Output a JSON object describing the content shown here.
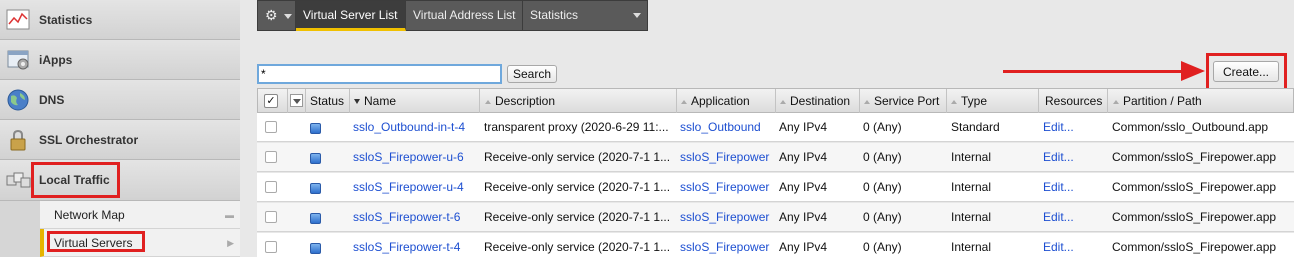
{
  "sidebar": {
    "items": [
      {
        "label": "Statistics",
        "icon": "statistics-icon"
      },
      {
        "label": "iApps",
        "icon": "iapps-icon"
      },
      {
        "label": "DNS",
        "icon": "dns-globe-icon"
      },
      {
        "label": "SSL Orchestrator",
        "icon": "lock-icon"
      },
      {
        "label": "Local Traffic",
        "icon": "local-traffic-icon"
      }
    ],
    "subitems": [
      {
        "label": "Network Map"
      },
      {
        "label": "Virtual Servers"
      }
    ]
  },
  "tabs": [
    {
      "label": "Virtual Server List"
    },
    {
      "label": "Virtual Address List"
    },
    {
      "label": "Statistics"
    }
  ],
  "gear_icon": "gear-icon",
  "search": {
    "value": "*",
    "button_label": "Search"
  },
  "create_button": "Create...",
  "columns": {
    "status": "Status",
    "name": "Name",
    "description": "Description",
    "application": "Application",
    "destination": "Destination",
    "service_port": "Service Port",
    "type": "Type",
    "resources": "Resources",
    "partition": "Partition / Path"
  },
  "rows": [
    {
      "name": "sslo_Outbound-in-t-4",
      "description": "transparent proxy (2020-6-29 11:...",
      "application": "sslo_Outbound",
      "destination": "Any IPv4",
      "port": "0 (Any)",
      "type": "Standard",
      "resources": "Edit...",
      "partition": "Common/sslo_Outbound.app"
    },
    {
      "name": "ssloS_Firepower-u-6",
      "description": "Receive-only service (2020-7-1 1...",
      "application": "ssloS_Firepower",
      "destination": "Any IPv4",
      "port": "0 (Any)",
      "type": "Internal",
      "resources": "Edit...",
      "partition": "Common/ssloS_Firepower.app"
    },
    {
      "name": "ssloS_Firepower-u-4",
      "description": "Receive-only service (2020-7-1 1...",
      "application": "ssloS_Firepower",
      "destination": "Any IPv4",
      "port": "0 (Any)",
      "type": "Internal",
      "resources": "Edit...",
      "partition": "Common/ssloS_Firepower.app"
    },
    {
      "name": "ssloS_Firepower-t-6",
      "description": "Receive-only service (2020-7-1 1...",
      "application": "ssloS_Firepower",
      "destination": "Any IPv4",
      "port": "0 (Any)",
      "type": "Internal",
      "resources": "Edit...",
      "partition": "Common/ssloS_Firepower.app"
    },
    {
      "name": "ssloS_Firepower-t-4",
      "description": "Receive-only service (2020-7-1 1...",
      "application": "ssloS_Firepower",
      "destination": "Any IPv4",
      "port": "0 (Any)",
      "type": "Internal",
      "resources": "Edit...",
      "partition": "Common/ssloS_Firepower.app"
    }
  ],
  "colors": {
    "highlight": "#e02020",
    "link": "#1d4fd1",
    "tab_accent": "#f0c000",
    "status": "#2e6fcc"
  }
}
